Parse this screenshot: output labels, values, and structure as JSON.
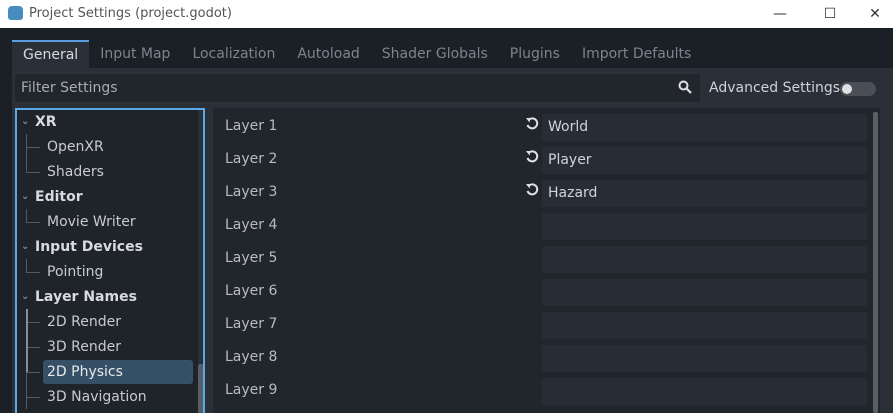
{
  "window": {
    "title": "Project Settings (project.godot)",
    "minimize": "—",
    "maximize": "☐",
    "close": "✕"
  },
  "tabs": [
    {
      "label": "General",
      "active": true
    },
    {
      "label": "Input Map"
    },
    {
      "label": "Localization"
    },
    {
      "label": "Autoload"
    },
    {
      "label": "Shader Globals"
    },
    {
      "label": "Plugins"
    },
    {
      "label": "Import Defaults"
    }
  ],
  "filter": {
    "placeholder": "Filter Settings"
  },
  "advanced": {
    "label": "Advanced Settings",
    "enabled": false
  },
  "tree": [
    {
      "label": "XR",
      "type": "cat"
    },
    {
      "label": "OpenXR",
      "type": "sub"
    },
    {
      "label": "Shaders",
      "type": "sub"
    },
    {
      "label": "Editor",
      "type": "cat"
    },
    {
      "label": "Movie Writer",
      "type": "sub"
    },
    {
      "label": "Input Devices",
      "type": "cat"
    },
    {
      "label": "Pointing",
      "type": "sub"
    },
    {
      "label": "Layer Names",
      "type": "cat"
    },
    {
      "label": "2D Render",
      "type": "sub"
    },
    {
      "label": "3D Render",
      "type": "sub"
    },
    {
      "label": "2D Physics",
      "type": "sub",
      "selected": true
    },
    {
      "label": "3D Navigation",
      "type": "sub"
    }
  ],
  "layers": [
    {
      "label": "Layer 1",
      "value": "World",
      "revert": true
    },
    {
      "label": "Layer 2",
      "value": "Player",
      "revert": true
    },
    {
      "label": "Layer 3",
      "value": "Hazard",
      "revert": true
    },
    {
      "label": "Layer 4",
      "value": ""
    },
    {
      "label": "Layer 5",
      "value": ""
    },
    {
      "label": "Layer 6",
      "value": ""
    },
    {
      "label": "Layer 7",
      "value": ""
    },
    {
      "label": "Layer 8",
      "value": ""
    },
    {
      "label": "Layer 9",
      "value": ""
    }
  ],
  "colors": {
    "accent": "#5aa8e8",
    "selection": "#365068"
  }
}
